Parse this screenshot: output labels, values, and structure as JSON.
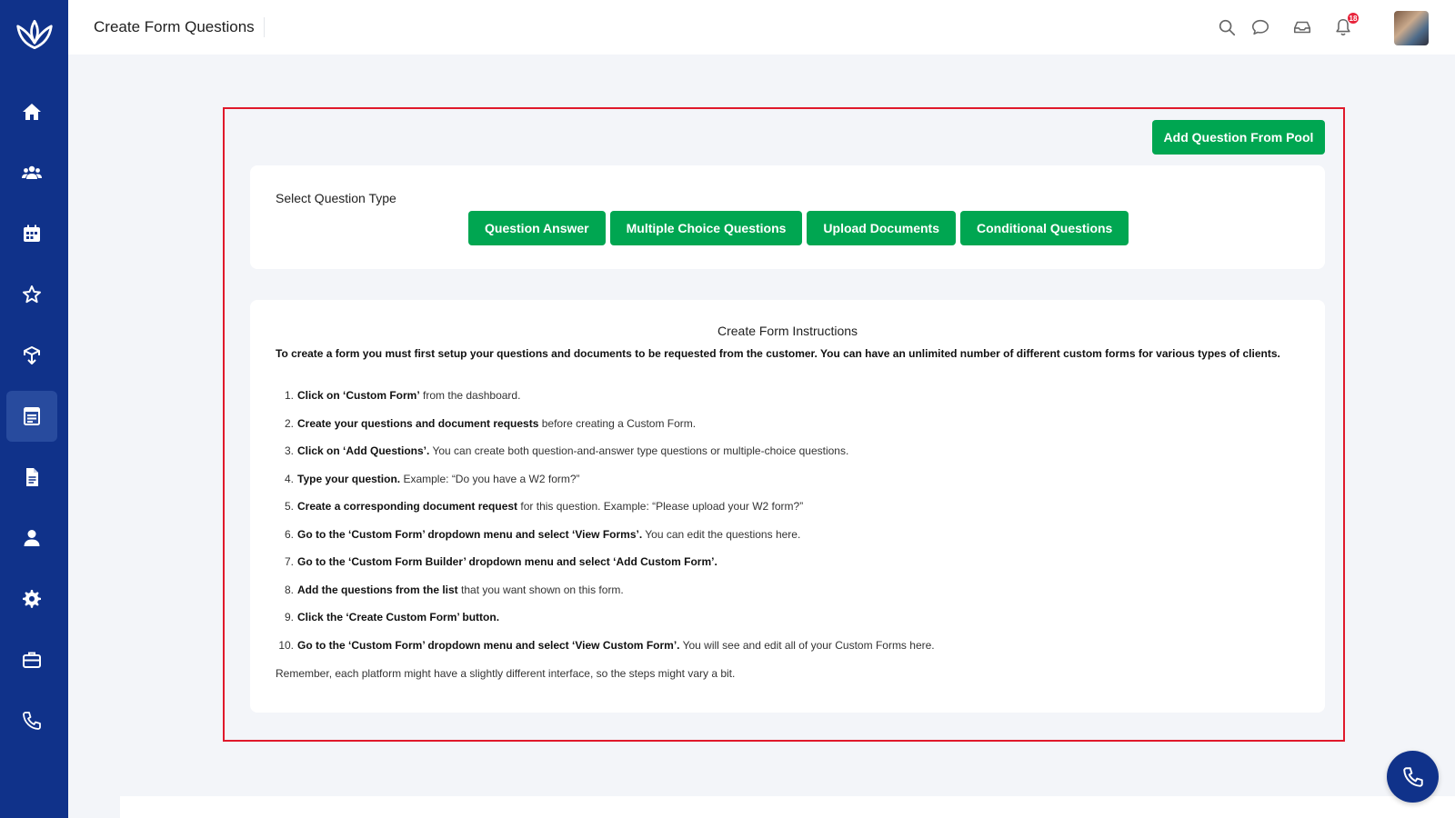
{
  "header": {
    "title": "Create Form Questions",
    "notification_count": "18"
  },
  "sidebar": {
    "items": [
      {
        "icon": "home-icon",
        "active": false
      },
      {
        "icon": "users-icon",
        "active": false
      },
      {
        "icon": "calendar-icon",
        "active": false
      },
      {
        "icon": "star-icon",
        "active": false
      },
      {
        "icon": "box-icon",
        "active": false
      },
      {
        "icon": "form-icon",
        "active": true
      },
      {
        "icon": "document-icon",
        "active": false
      },
      {
        "icon": "user-icon",
        "active": false
      },
      {
        "icon": "gear-icon",
        "active": false
      },
      {
        "icon": "briefcase-icon",
        "active": false
      },
      {
        "icon": "phone-icon",
        "active": false
      }
    ]
  },
  "actions": {
    "add_from_pool": "Add Question From Pool"
  },
  "question_type": {
    "label": "Select Question Type",
    "buttons": [
      "Question Answer",
      "Multiple Choice Questions",
      "Upload Documents",
      "Conditional Questions"
    ]
  },
  "instructions": {
    "title": "Create Form Instructions",
    "intro": "To create a form you must first setup your questions and documents to be requested from the customer. You can have an unlimited number of different custom forms for various types of clients.",
    "steps": [
      {
        "num": "1.",
        "bold": "Click on ‘Custom Form’",
        "text": " from the dashboard."
      },
      {
        "num": "2.",
        "bold": "Create your questions and document requests",
        "text": " before creating a Custom Form."
      },
      {
        "num": "3.",
        "bold": "Click on ‘Add Questions’.",
        "text": " You can create both question-and-answer type questions or multiple-choice questions."
      },
      {
        "num": "4.",
        "bold": "Type your question.",
        "text": " Example: “Do you have a W2 form?”"
      },
      {
        "num": "5.",
        "bold": "Create a corresponding document request",
        "text": " for this question. Example: “Please upload your W2 form?”"
      },
      {
        "num": "6.",
        "bold": "Go to the ‘Custom Form’ dropdown menu and select ‘View Forms’.",
        "text": " You can edit the questions here."
      },
      {
        "num": "7.",
        "bold": "Go to the ‘Custom Form Builder’ dropdown menu and select ‘Add Custom Form’.",
        "text": ""
      },
      {
        "num": "8.",
        "bold": "Add the questions from the list",
        "text": " that you want shown on this form."
      },
      {
        "num": "9.",
        "bold": "Click the ‘Create Custom Form’ button.",
        "text": ""
      },
      {
        "num": "10.",
        "bold": "Go to the ‘Custom Form’ dropdown menu and select ‘View Custom Form’.",
        "text": " You will see and edit all of your Custom Forms here."
      }
    ],
    "footer": "Remember, each platform might have a slightly different interface, so the steps might vary a bit."
  },
  "colors": {
    "sidebar": "#10328a",
    "accent_green": "#00a651",
    "highlight_border": "#e0192b"
  }
}
